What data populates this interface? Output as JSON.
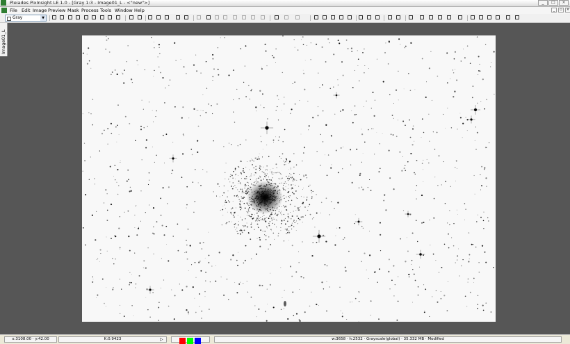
{
  "window": {
    "title": "Pleiades PixInsight LE 1.0 - [Gray 1:3 - Image01_L - <\"new\">]"
  },
  "menu": [
    "File",
    "Edit",
    "Image",
    "Preview",
    "Mask",
    "Process",
    "Tools",
    "Window",
    "Help"
  ],
  "toolbar": {
    "colorspace_value": "Gray"
  },
  "image": {
    "tab_label": "Image01_L"
  },
  "status": {
    "coords": "x:3108.00 · y:42.00",
    "k_value": "K:0.9423",
    "channels": {
      "red": "#ff0000",
      "green": "#00ff00",
      "blue": "#0000ff"
    },
    "info": "w:3658 · h:2532 · Grayscale(global) · 35.332 MB · Modified"
  }
}
